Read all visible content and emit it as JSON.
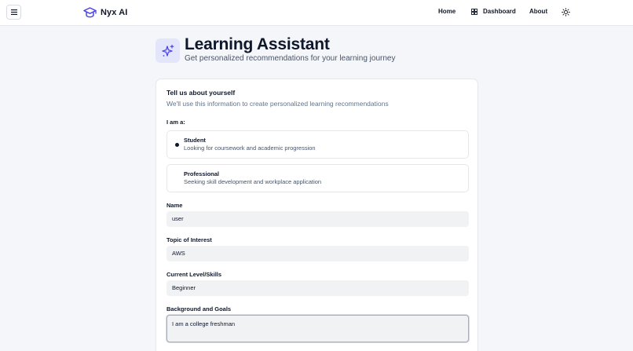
{
  "header": {
    "brand": "Nyx AI",
    "nav": {
      "home": "Home",
      "dashboard": "Dashboard",
      "about": "About"
    }
  },
  "hero": {
    "title": "Learning Assistant",
    "subtitle": "Get personalized recommendations for your learning journey"
  },
  "form": {
    "title": "Tell us about yourself",
    "description": "We'll use this information to create personalized learning recommendations",
    "role_label": "I am a:",
    "roles": [
      {
        "title": "Student",
        "description": "Looking for coursework and academic progression",
        "selected": true
      },
      {
        "title": "Professional",
        "description": "Seeking skill development and workplace application",
        "selected": false
      }
    ],
    "name": {
      "label": "Name",
      "value": "user"
    },
    "topic": {
      "label": "Topic of Interest",
      "value": "AWS"
    },
    "level": {
      "label": "Current Level/Skills",
      "value": "Beginner"
    },
    "background": {
      "label": "Background and Goals",
      "value": "I am a college freshman"
    }
  },
  "colors": {
    "accent": "#4f46e5",
    "accent_bg": "#e3e6fb",
    "page_bg": "#f5f6f9",
    "input_bg": "#f1f2f4"
  }
}
